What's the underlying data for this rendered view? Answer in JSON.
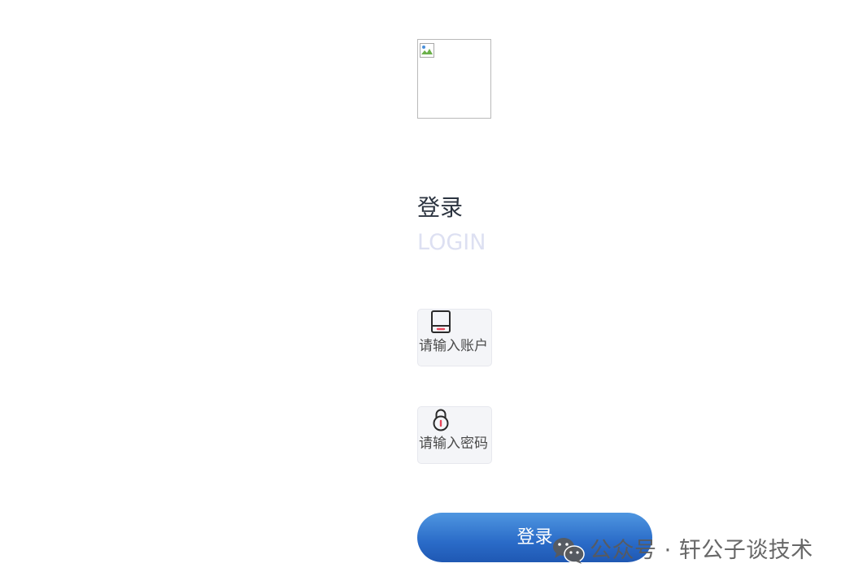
{
  "logo": {
    "alt": ""
  },
  "header": {
    "title": "登录",
    "subtitle": "LOGIN"
  },
  "form": {
    "account": {
      "icon": "phone-icon",
      "placeholder": "请输入账户",
      "value": ""
    },
    "password": {
      "icon": "lock-icon",
      "placeholder": "请输入密码",
      "value": ""
    },
    "submit_label": "登录"
  },
  "watermark": {
    "icon": "wechat-icon",
    "text": "公众号 · 轩公子谈技术"
  },
  "colors": {
    "button_gradient_top": "#4f96e0",
    "button_gradient_bottom": "#1f58b3",
    "title": "#2c3440",
    "subtitle": "#dde0f2",
    "field_background": "#f4f5f8",
    "icon_accent": "#e8465a"
  }
}
